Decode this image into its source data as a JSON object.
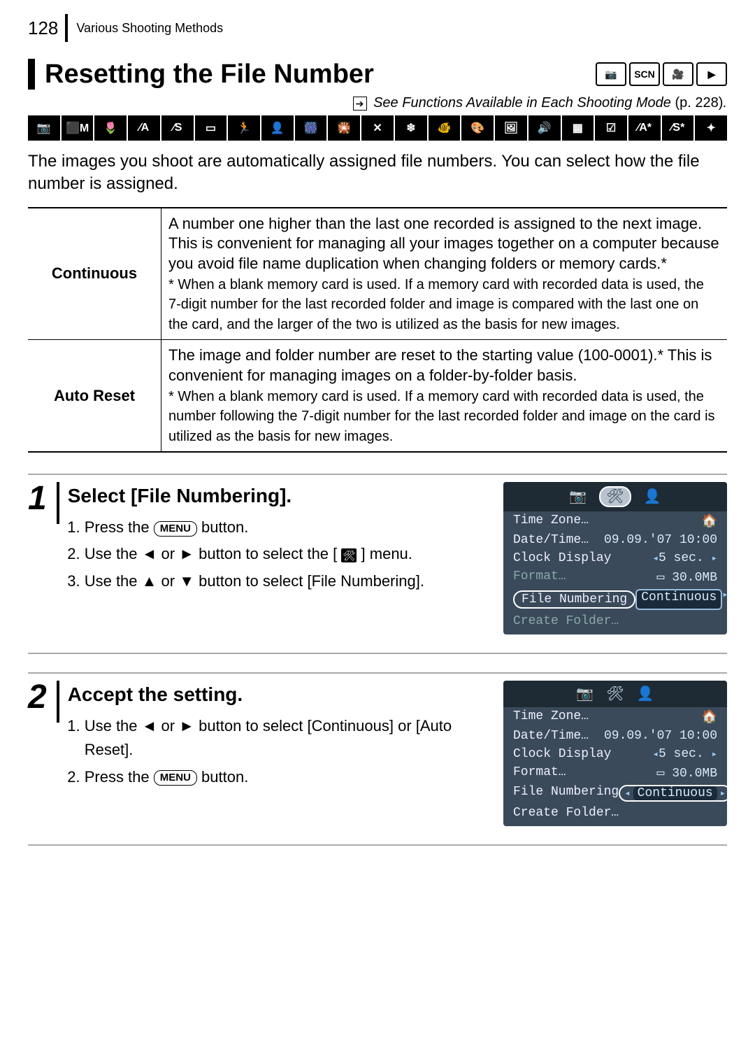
{
  "header": {
    "page_number": "128",
    "breadcrumb": "Various Shooting Methods"
  },
  "title": "Resetting the File Number",
  "badges": [
    "📷",
    "SCN",
    "🎥",
    "▶"
  ],
  "see_ref": {
    "text": "See Functions Available in Each Shooting Mode",
    "page": "(p. 228)"
  },
  "mode_strip": [
    "📷",
    "⬛M",
    "🌷",
    "⁄A",
    "⁄S",
    "▭",
    "🏃",
    "👤",
    "🎆",
    "🎇",
    "✕",
    "❄",
    "🐠",
    "🎨",
    "🖼",
    "🔊",
    "▦",
    "☑",
    "⁄A*",
    "⁄S*",
    "✦"
  ],
  "intro": "The images you shoot are automatically assigned file numbers. You can select how the file number is assigned.",
  "options": [
    {
      "label": "Continuous",
      "desc": "A number one higher than the last one recorded is assigned to the next image. This is convenient for managing all your images together on a computer because you avoid file name duplication when changing folders or memory cards.*",
      "note": "* When a blank memory card is used. If a memory card with recorded data is used, the 7-digit number for the last recorded folder and image is compared with the last one on the card, and the larger of the two is utilized as the basis for new images."
    },
    {
      "label": "Auto Reset",
      "desc": "The image and folder number are reset to the starting value (100-0001).* This is convenient for managing images on a folder-by-folder basis.",
      "note": "* When a blank memory card is used. If a memory card with recorded data is used, the number following the 7-digit number for the last recorded folder and image on the card is utilized as the basis for new images."
    }
  ],
  "steps": [
    {
      "num": "1",
      "title": "Select [File Numbering].",
      "items": [
        {
          "pre": "Press the ",
          "btn": "MENU",
          "post": " button."
        },
        {
          "pre": "Use the ",
          "a1": "◄",
          "mid1": " or ",
          "a2": "►",
          "post1": " button to select the [",
          "icon": "🛠",
          "post2": "] menu."
        },
        {
          "pre": "Use the ",
          "a1": "▲",
          "mid1": " or ",
          "a2": "▼",
          "post1": " button to select [File Numbering]."
        }
      ],
      "screen_highlight": "row"
    },
    {
      "num": "2",
      "title": "Accept the setting.",
      "items": [
        {
          "pre": "Use the ",
          "a1": "◄",
          "mid1": " or ",
          "a2": "►",
          "post1": " button to select [Continuous] or [Auto Reset]."
        },
        {
          "pre": "Press the ",
          "btn": "MENU",
          "post": " button."
        }
      ],
      "screen_highlight": "value"
    }
  ],
  "mini_screen": {
    "tabs": [
      "📷",
      "🛠",
      "👤"
    ],
    "rows": {
      "time_zone": {
        "l": "Time Zone…",
        "r": "🏠"
      },
      "date_time": {
        "l": "Date/Time…",
        "r": "09.09.'07 10:00"
      },
      "clock": {
        "l": "Clock Display",
        "r": "5 sec."
      },
      "format": {
        "l": "Format…",
        "r": "30.0MB"
      },
      "file_num": {
        "l": "File Numbering",
        "r": "Continuous"
      },
      "create": {
        "l": "Create Folder…",
        "r": ""
      }
    }
  }
}
